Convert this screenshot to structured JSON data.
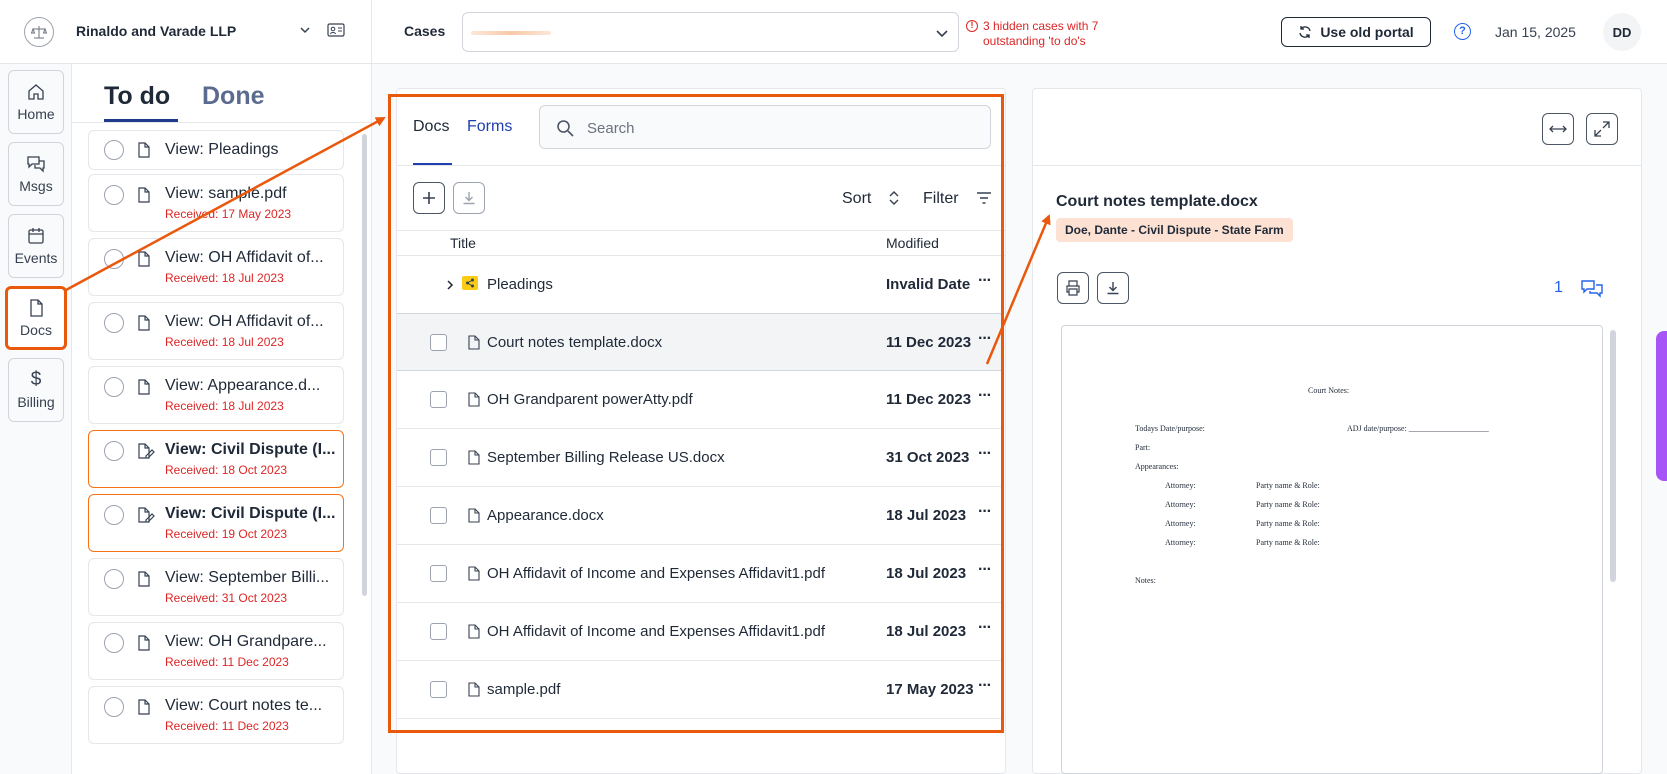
{
  "header": {
    "firm_name": "Rinaldo and Varade LLP",
    "cases_label": "Cases",
    "hidden_warning": "3 hidden cases with 7 outstanding 'to do's",
    "old_portal_label": "Use old portal",
    "date": "Jan 15, 2025",
    "avatar_initials": "DD",
    "logo_text": "LAW FIRM"
  },
  "nav": {
    "items": [
      {
        "label": "Home",
        "icon": "home-icon"
      },
      {
        "label": "Msgs",
        "icon": "messages-icon"
      },
      {
        "label": "Events",
        "icon": "calendar-icon"
      },
      {
        "label": "Docs",
        "icon": "document-icon",
        "active": true
      },
      {
        "label": "Billing",
        "icon": "dollar-icon"
      }
    ]
  },
  "todo": {
    "tab_todo": "To do",
    "tab_done": "Done",
    "items": [
      {
        "title": "View: Pleadings",
        "received": ""
      },
      {
        "title": "View: sample.pdf",
        "received": "Received: 17 May 2023"
      },
      {
        "title": "View: OH Affidavit of...",
        "received": "Received: 18 Jul 2023"
      },
      {
        "title": "View: OH Affidavit of...",
        "received": "Received: 18 Jul 2023"
      },
      {
        "title": "View: Appearance.d...",
        "received": "Received: 18 Jul 2023"
      },
      {
        "title": "View: Civil Dispute (I...",
        "received": "Received: 18 Oct 2023",
        "highlight": true
      },
      {
        "title": "View: Civil Dispute (I...",
        "received": "Received: 19 Oct 2023",
        "highlight": true
      },
      {
        "title": "View: September Billi...",
        "received": "Received: 31 Oct 2023"
      },
      {
        "title": "View: OH Grandpare...",
        "received": "Received: 11 Dec 2023"
      },
      {
        "title": "View: Court notes te...",
        "received": "Received: 11 Dec 2023"
      }
    ]
  },
  "docs": {
    "tab_docs": "Docs",
    "tab_forms": "Forms",
    "search_placeholder": "Search",
    "sort_label": "Sort",
    "filter_label": "Filter",
    "col_title": "Title",
    "col_modified": "Modified",
    "rows": [
      {
        "name": "Pleadings",
        "modified": "Invalid Date",
        "folder": true
      },
      {
        "name": "Court notes template.docx",
        "modified": "11 Dec 2023",
        "selected": true
      },
      {
        "name": "OH Grandparent powerAtty.pdf",
        "modified": "11 Dec 2023"
      },
      {
        "name": "September Billing Release US.docx",
        "modified": "31 Oct 2023"
      },
      {
        "name": "Appearance.docx",
        "modified": "18 Jul 2023"
      },
      {
        "name": "OH Affidavit of Income and Expenses Affidavit1.pdf",
        "modified": "18 Jul 2023"
      },
      {
        "name": "OH Affidavit of Income and Expenses Affidavit1.pdf",
        "modified": "18 Jul 2023"
      },
      {
        "name": "sample.pdf",
        "modified": "17 May 2023"
      }
    ]
  },
  "preview": {
    "title": "Court notes template.docx",
    "case_badge": "Doe, Dante - Civil Dispute - State Farm",
    "comment_count": "1",
    "doc": {
      "heading": "Court Notes:",
      "todays_date": "Todays Date/purpose:",
      "adj_date": "ADJ date/purpose: ____________________",
      "part": "Part:",
      "appearances": "Appearances:",
      "attorney": "Attorney:",
      "party": "Party name & Role:",
      "notes": "Notes:"
    }
  },
  "colors": {
    "accent": "#ea580c",
    "link": "#1e40af",
    "error": "#dc2626",
    "badge_bg": "#fde2d3"
  }
}
